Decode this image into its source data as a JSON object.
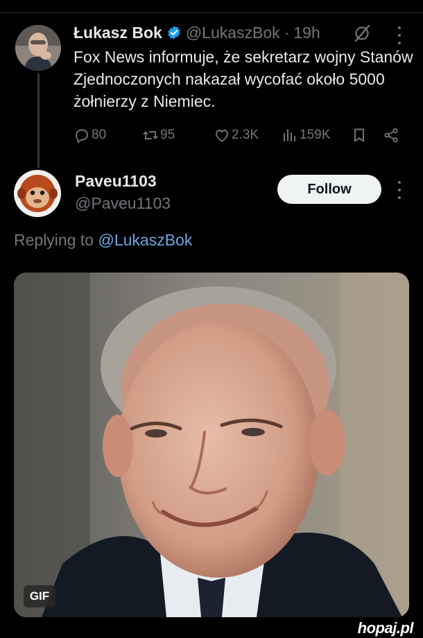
{
  "original_tweet": {
    "author_name": "Łukasz Bok",
    "author_handle": "@LukaszBok",
    "separator": "·",
    "time": "19h",
    "text": "Fox News informuje, że sekretarz wojny Stanów Zjednoczonych nakazał wycofać około 5000 żołnierzy z Niemiec.",
    "verified_color": "#1d9bf0",
    "actions": {
      "replies": "80",
      "reposts": "95",
      "likes": "2.3K",
      "views": "159K"
    },
    "icons": [
      "verified-badge-icon",
      "grok-icon",
      "more-icon",
      "reply-icon",
      "repost-icon",
      "like-icon",
      "views-icon",
      "bookmark-icon",
      "share-icon"
    ]
  },
  "reply": {
    "author_name": "Paveu1103",
    "author_handle": "@Paveu1103",
    "follow_label": "Follow",
    "replying_prefix": "Replying to",
    "replying_to": "@LukaszBok",
    "media_badge": "GIF"
  },
  "watermark": {
    "brand": "hopaj",
    "suffix": ".pl"
  },
  "colors": {
    "background": "#000000",
    "text_primary": "#e7e9ea",
    "text_secondary": "#71767b",
    "link": "#6ca7e6",
    "follow_button_bg": "#eff3f4"
  }
}
